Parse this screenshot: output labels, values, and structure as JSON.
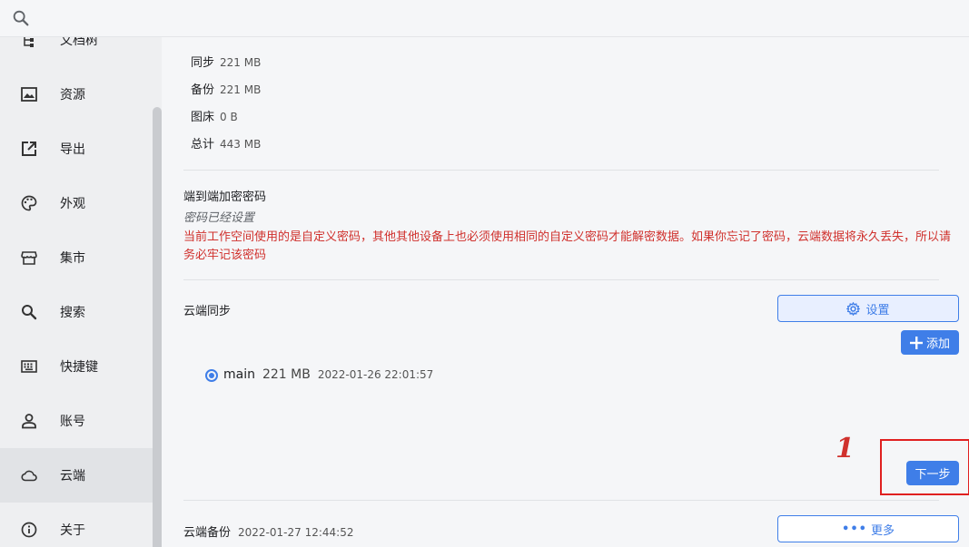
{
  "sidebar": {
    "items": [
      {
        "label": "文档树",
        "icon": "tree-icon"
      },
      {
        "label": "资源",
        "icon": "image-icon"
      },
      {
        "label": "导出",
        "icon": "export-icon"
      },
      {
        "label": "外观",
        "icon": "palette-icon"
      },
      {
        "label": "集市",
        "icon": "store-icon"
      },
      {
        "label": "搜索",
        "icon": "search-icon"
      },
      {
        "label": "快捷键",
        "icon": "keyboard-icon"
      },
      {
        "label": "账号",
        "icon": "account-icon"
      },
      {
        "label": "云端",
        "icon": "cloud-icon",
        "active": true
      },
      {
        "label": "关于",
        "icon": "info-icon"
      }
    ]
  },
  "storage": {
    "rows": [
      {
        "label": "同步",
        "value": "221 MB"
      },
      {
        "label": "备份",
        "value": "221 MB"
      },
      {
        "label": "图床",
        "value": "0 B"
      },
      {
        "label": "总计",
        "value": "443 MB"
      }
    ]
  },
  "encryption": {
    "title": "端到端加密密码",
    "status": "密码已经设置",
    "warning": "当前工作空间使用的是自定义密码，其他其他设备上也必须使用相同的自定义密码才能解密数据。如果你忘记了密码，云端数据将永久丢失，所以请务必牢记该密码"
  },
  "sync": {
    "title": "云端同步",
    "settings_label": "设置",
    "add_label": "添加",
    "repo": {
      "name": "main",
      "size": "221 MB",
      "date": "2022-01-26 22:01:57",
      "selected": true
    },
    "next_label": "下一步"
  },
  "annotation": {
    "number": "1",
    "color": "#e02020"
  },
  "backup": {
    "title": "云端备份",
    "date": "2022-01-27 12:44:52",
    "more_label": "更多"
  },
  "colors": {
    "accent": "#3f7ee8",
    "warning": "#d0312d"
  }
}
